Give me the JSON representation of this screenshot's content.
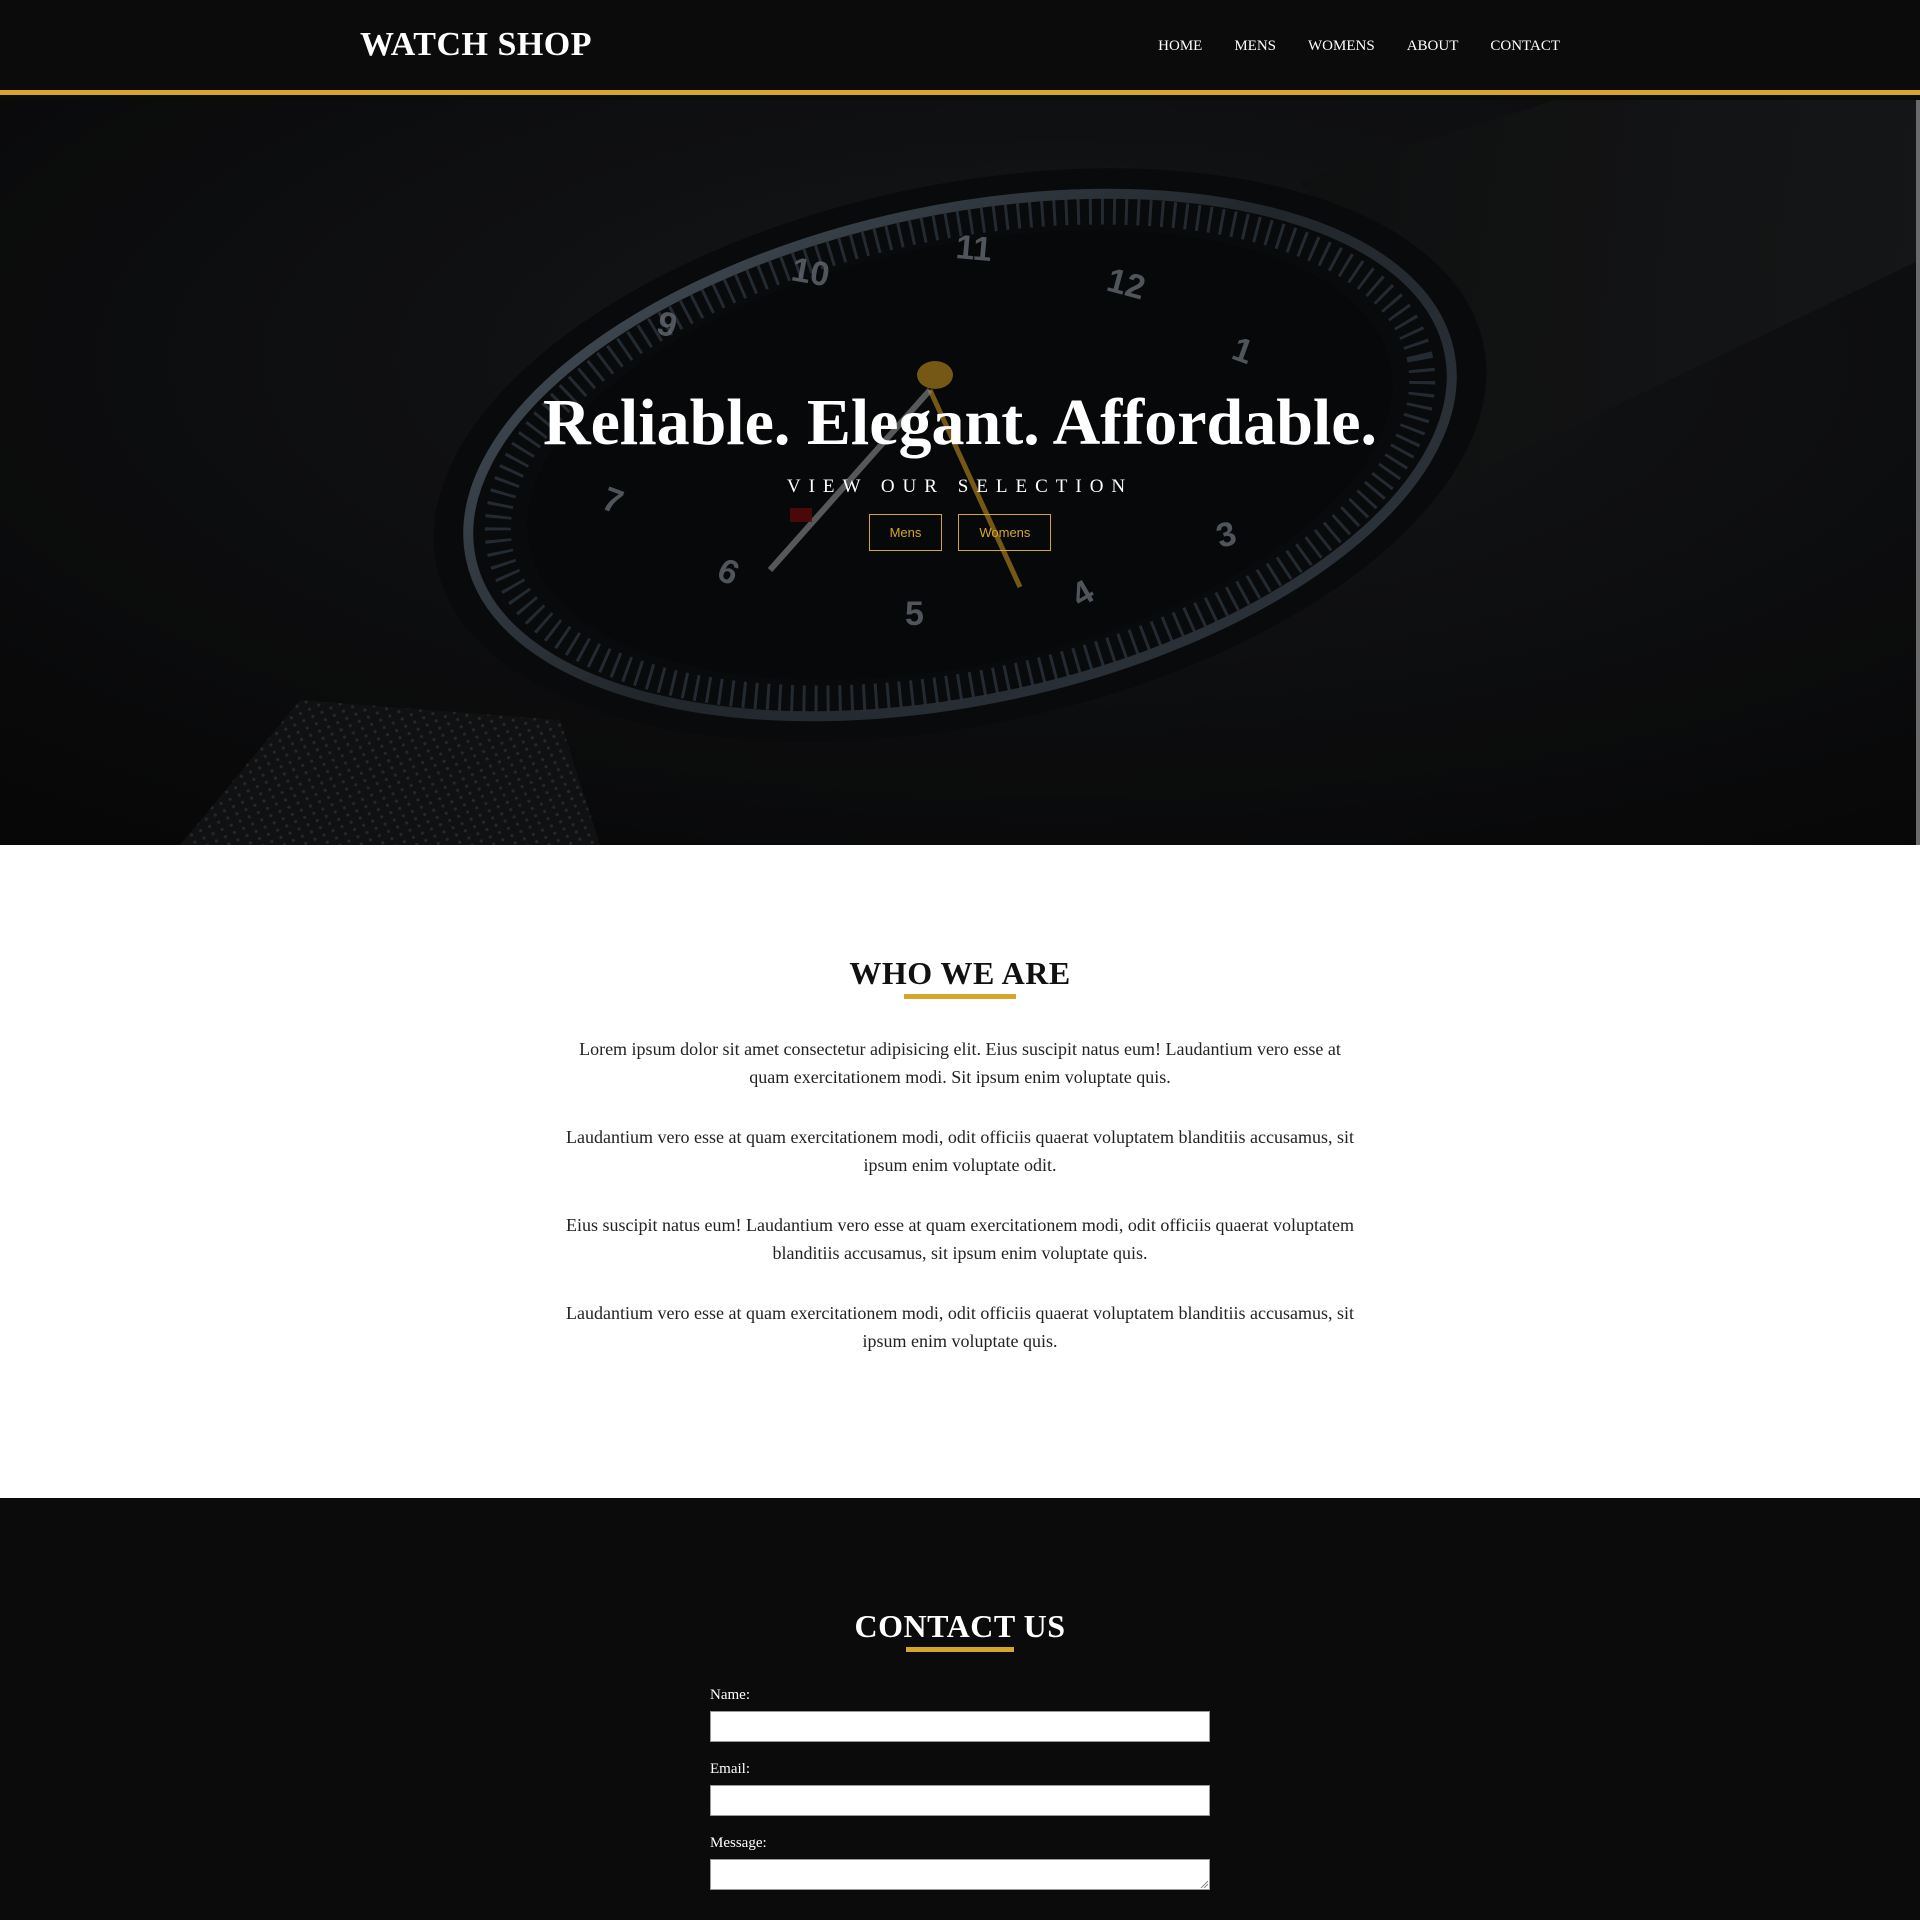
{
  "nav": {
    "brand": "WATCH SHOP",
    "links": [
      "HOME",
      "MENS",
      "WOMENS",
      "ABOUT",
      "CONTACT"
    ]
  },
  "hero": {
    "title": "Reliable. Elegant. Affordable.",
    "subtitle": "VIEW OUR SELECTION",
    "buttons": [
      "Mens",
      "Womens"
    ]
  },
  "about": {
    "heading": "WHO WE ARE",
    "paragraphs": [
      "Lorem ipsum dolor sit amet consectetur adipisicing elit. Eius suscipit natus eum! Laudantium vero esse at quam exercitationem modi. Sit ipsum enim voluptate quis.",
      "Laudantium vero esse at quam exercitationem modi, odit officiis quaerat voluptatem blanditiis accusamus, sit ipsum enim voluptate odit.",
      "Eius suscipit natus eum! Laudantium vero esse at quam exercitationem modi, odit officiis quaerat voluptatem blanditiis accusamus, sit ipsum enim voluptate quis.",
      "Laudantium vero esse at quam exercitationem modi, odit officiis quaerat voluptatem blanditiis accusamus, sit ipsum enim voluptate quis."
    ]
  },
  "contact": {
    "heading": "CONTACT US",
    "name_label": "Name:",
    "email_label": "Email:",
    "message_label": "Message:"
  },
  "colors": {
    "accent": "#d4a72c",
    "dark_bg": "#0b0b0b",
    "light_bg": "#ffffff"
  }
}
